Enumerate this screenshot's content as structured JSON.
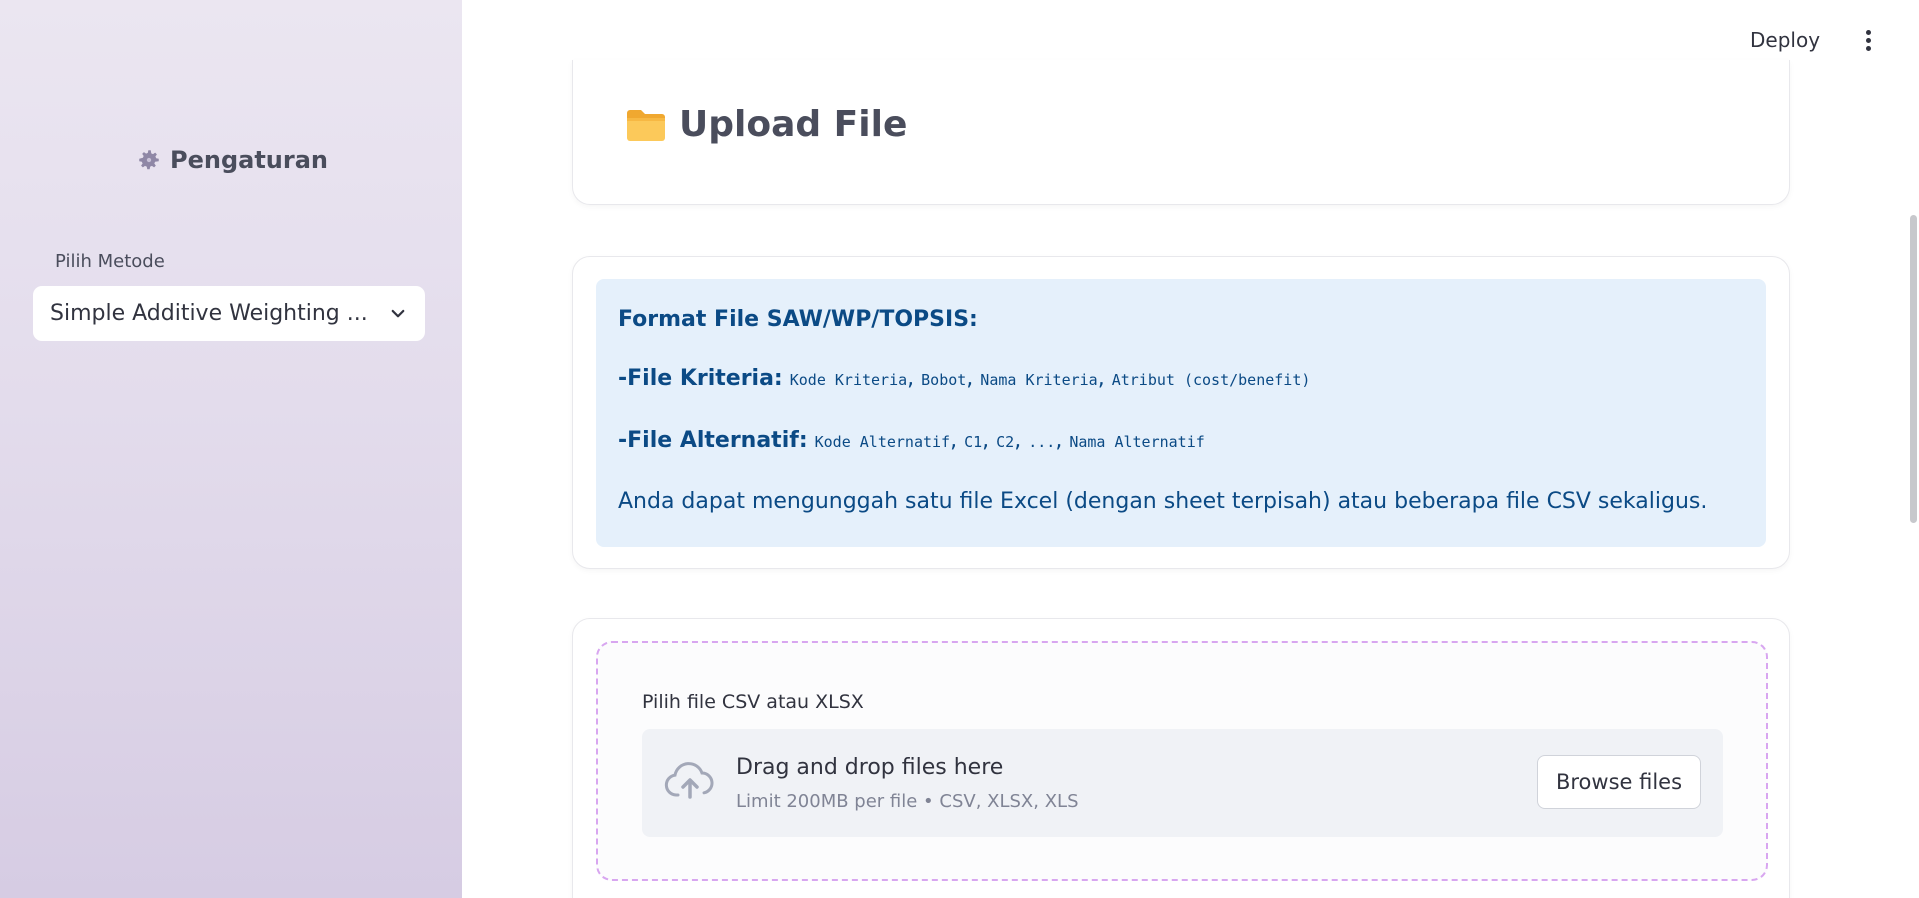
{
  "sidebar": {
    "title": "Pengaturan",
    "method_label": "Pilih Metode",
    "method_value": "Simple Additive Weighting ..."
  },
  "header": {
    "deploy_label": "Deploy",
    "menu_icon": "kebab-menu-icon"
  },
  "upload_card": {
    "title": "Upload File",
    "icon": "folder-icon"
  },
  "info_box": {
    "heading": "Format File SAW/WP/TOPSIS:",
    "kriteria_label": "-File Kriteria:",
    "kriteria_columns": [
      "Kode Kriteria",
      "Bobot",
      "Nama Kriteria",
      "Atribut (cost/benefit)"
    ],
    "alternatif_label": "-File Alternatif:",
    "alternatif_columns": [
      "Kode Alternatif",
      "C1",
      "C2",
      "...",
      "Nama Alternatif"
    ],
    "note": "Anda dapat mengunggah satu file Excel (dengan sheet terpisah) atau beberapa file CSV sekaligus."
  },
  "uploader": {
    "label": "Pilih file CSV atau XLSX",
    "drag_text": "Drag and drop files here",
    "limit_text": "Limit 200MB per file • CSV, XLSX, XLS",
    "browse_label": "Browse files"
  },
  "colors": {
    "info_bg": "#e5f0fb",
    "info_text": "#0b4a85",
    "dashed_border": "#d8a6f0",
    "sidebar_bg": "#e3dcec"
  }
}
